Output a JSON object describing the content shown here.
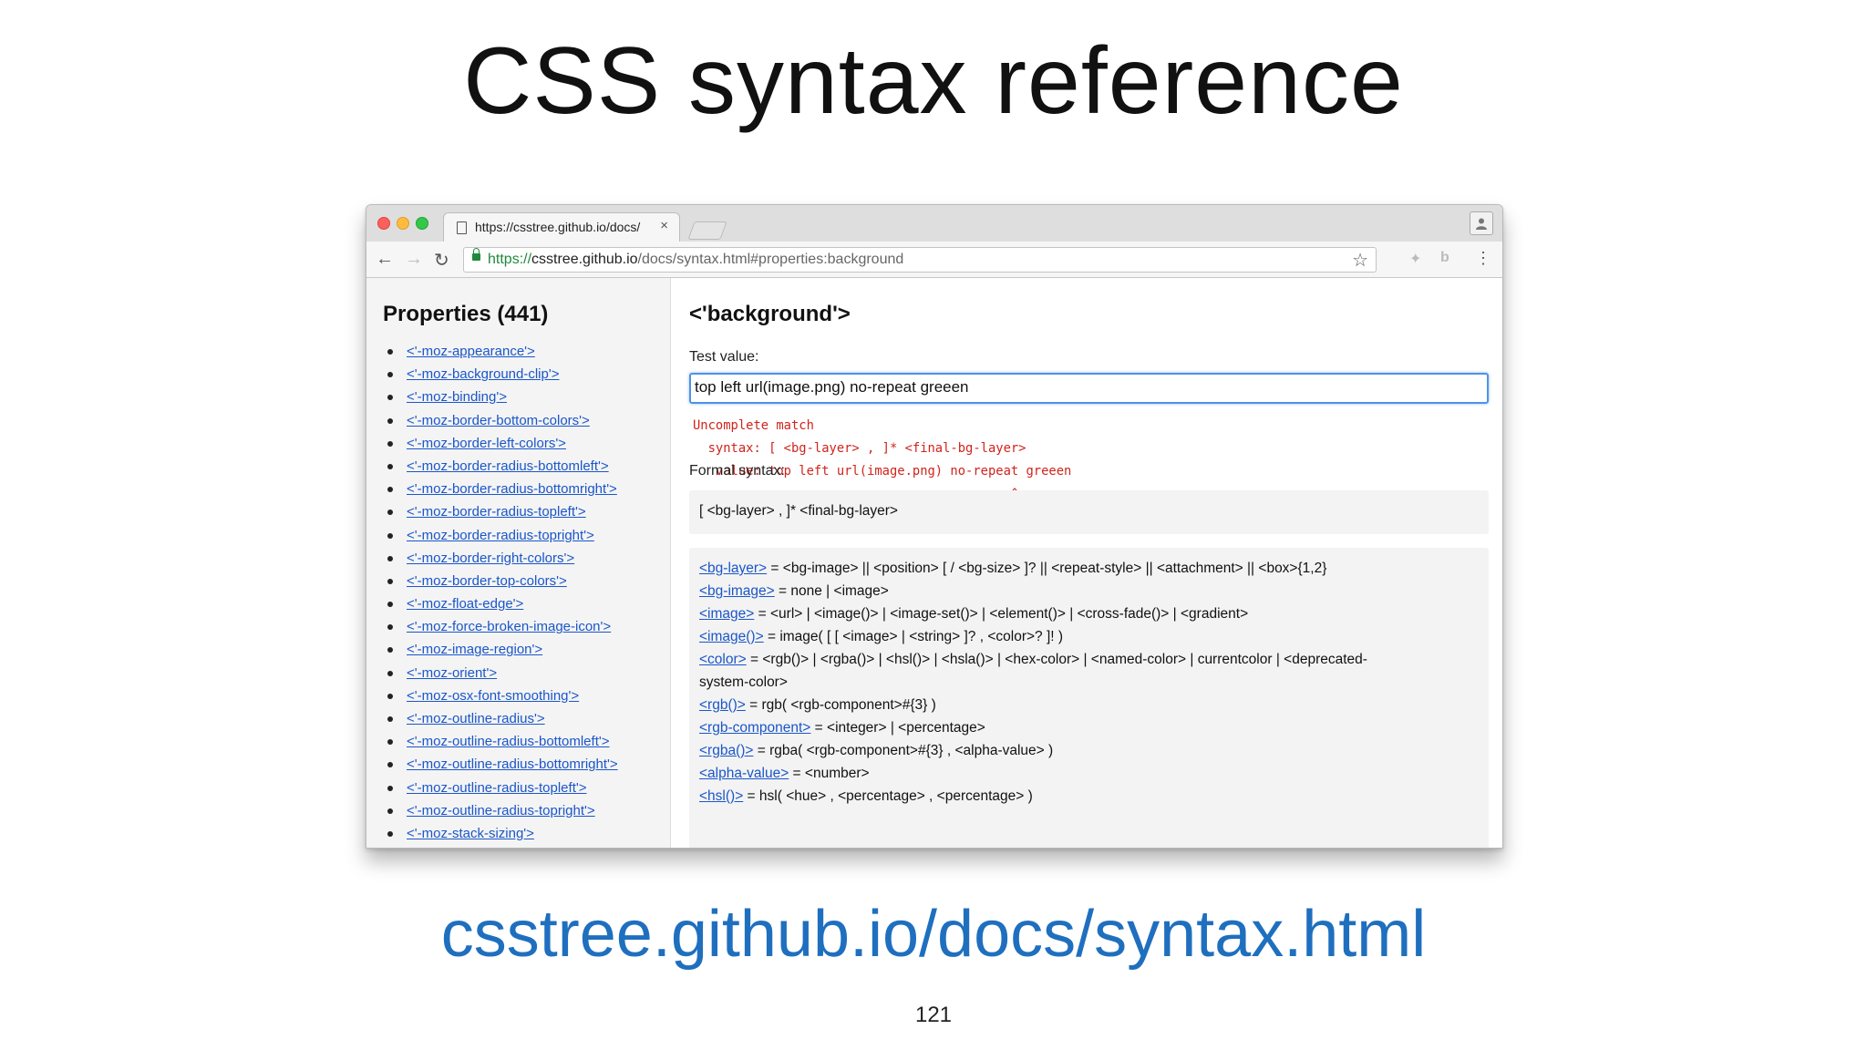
{
  "slide": {
    "title": "CSS syntax reference",
    "link": "csstree.github.io/docs/syntax.html",
    "page_number": "121"
  },
  "browser": {
    "tab": {
      "title": "https://csstree.github.io/docs/",
      "close": "×"
    },
    "toolbar": {
      "back": "←",
      "forward": "→",
      "reload": "↻",
      "url_scheme": "https://",
      "url_host": "csstree.github.io",
      "url_path": "/docs/syntax.html#properties:background",
      "bookmark": "☆",
      "menu": "⋮",
      "ext1": "✦",
      "ext2": "b"
    },
    "icons": [
      "page-icon",
      "lock-icon",
      "star-icon",
      "profile-icon",
      "menu-icon"
    ]
  },
  "sidebar": {
    "heading": "Properties (441)",
    "items": [
      "<'-moz-appearance'>",
      "<'-moz-background-clip'>",
      "<'-moz-binding'>",
      "<'-moz-border-bottom-colors'>",
      "<'-moz-border-left-colors'>",
      "<'-moz-border-radius-bottomleft'>",
      "<'-moz-border-radius-bottomright'>",
      "<'-moz-border-radius-topleft'>",
      "<'-moz-border-radius-topright'>",
      "<'-moz-border-right-colors'>",
      "<'-moz-border-top-colors'>",
      "<'-moz-float-edge'>",
      "<'-moz-force-broken-image-icon'>",
      "<'-moz-image-region'>",
      "<'-moz-orient'>",
      "<'-moz-osx-font-smoothing'>",
      "<'-moz-outline-radius'>",
      "<'-moz-outline-radius-bottomleft'>",
      "<'-moz-outline-radius-bottomright'>",
      "<'-moz-outline-radius-topleft'>",
      "<'-moz-outline-radius-topright'>",
      "<'-moz-stack-sizing'>"
    ]
  },
  "main": {
    "heading": "<'background'>",
    "test_label": "Test value:",
    "test_value": "top left url(image.png) no-repeat greeen",
    "error": {
      "line1": "Uncomplete match",
      "line2": "  syntax: [ <bg-layer> , ]* <final-bg-layer>",
      "line3": "   value: top left url(image.png) no-repeat greeen",
      "line4": "  ----------------------------------------^"
    },
    "formal_label": "Formal syntax:",
    "formal": "[ <bg-layer> , ]* <final-bg-layer>",
    "definitions": [
      {
        "name": "<bg-layer>",
        "def": " = <bg-image> || <position> [ / <bg-size> ]? || <repeat-style> || <attachment> || <box>{1,2}"
      },
      {
        "name": "<bg-image>",
        "def": " = none | <image>"
      },
      {
        "name": "<image>",
        "def": " = <url> | <image()> | <image-set()> | <element()> | <cross-fade()> | <gradient>"
      },
      {
        "name": "<image()>",
        "def": " = image( [ [ <image> | <string> ]? , <color>? ]! )"
      },
      {
        "name": "<color>",
        "def": " = <rgb()> | <rgba()> | <hsl()> | <hsla()> | <hex-color> | <named-color> | currentcolor | <deprecated-"
      },
      {
        "name": "",
        "def": "system-color>"
      },
      {
        "name": "<rgb()>",
        "def": " = rgb( <rgb-component>#{3} )"
      },
      {
        "name": "<rgb-component>",
        "def": " = <integer> | <percentage>"
      },
      {
        "name": "<rgba()>",
        "def": " = rgba( <rgb-component>#{3} , <alpha-value> )"
      },
      {
        "name": "<alpha-value>",
        "def": " = <number>"
      },
      {
        "name": "<hsl()>",
        "def": " = hsl( <hue> , <percentage> , <percentage> )"
      }
    ]
  },
  "colors": {
    "link": "#1a56c9",
    "error": "#d0231b",
    "slide_link": "#1f6fbf",
    "focus_border": "#4f92e8"
  }
}
